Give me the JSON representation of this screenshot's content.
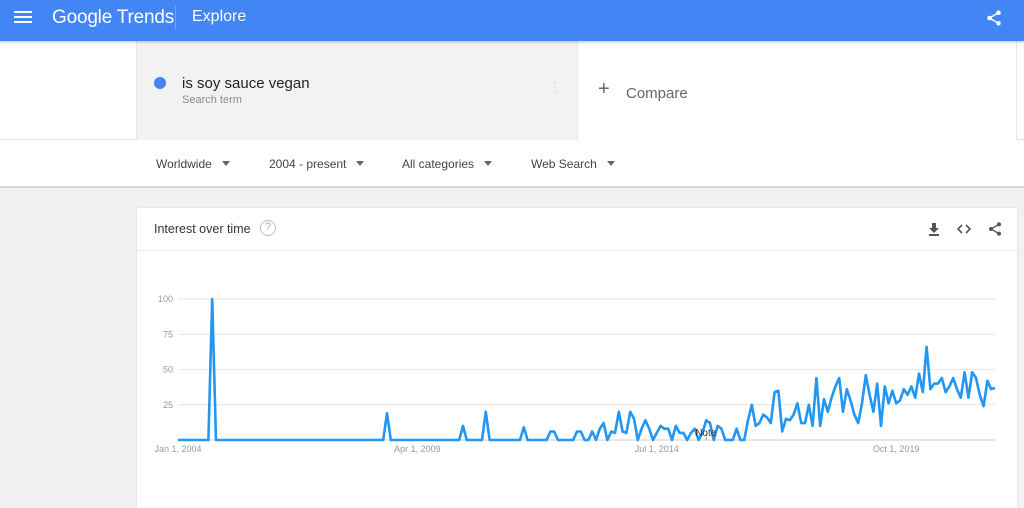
{
  "header": {
    "logo": "Google Trends",
    "section": "Explore",
    "menu_icon": "hamburger-menu-icon",
    "share_icon": "share-icon",
    "color": "#4285f4"
  },
  "search": {
    "term": "is soy sauce vegan",
    "term_type": "Search term",
    "term_color": "#4285f4",
    "compare_label": "Compare",
    "compare_icon": "+"
  },
  "filters": {
    "region": "Worldwide",
    "time_range": "2004 - present",
    "category": "All categories",
    "property": "Web Search"
  },
  "card": {
    "title": "Interest over time",
    "help_icon": "?",
    "actions": [
      "download-icon",
      "embed-icon",
      "share-icon"
    ]
  },
  "chart_data": {
    "type": "line",
    "title": "Interest over time",
    "series": [
      {
        "name": "is soy sauce vegan",
        "color": "#2196f3"
      }
    ],
    "x_start": "Jan 2004",
    "x_tick_labels": [
      "Jan 1, 2004",
      "Apr 1, 2009",
      "Jul 1, 2014",
      "Oct 1, 2019"
    ],
    "x_tick_months": [
      0,
      63,
      126,
      189
    ],
    "y_tick_labels": [
      "25",
      "50",
      "75",
      "100"
    ],
    "y_ticks": [
      25,
      50,
      75,
      100
    ],
    "ylim": [
      0,
      100
    ],
    "grid": true,
    "annotation": {
      "label": "Note",
      "month": 139
    },
    "values": [
      0,
      0,
      0,
      0,
      0,
      0,
      0,
      0,
      0,
      100,
      0,
      0,
      0,
      0,
      0,
      0,
      0,
      0,
      0,
      0,
      0,
      0,
      0,
      0,
      0,
      0,
      0,
      0,
      0,
      0,
      0,
      0,
      0,
      0,
      0,
      0,
      0,
      0,
      0,
      0,
      0,
      0,
      0,
      0,
      0,
      0,
      0,
      0,
      0,
      0,
      0,
      0,
      0,
      0,
      0,
      19,
      0,
      0,
      0,
      0,
      0,
      0,
      0,
      0,
      0,
      0,
      0,
      0,
      0,
      0,
      0,
      0,
      0,
      0,
      0,
      10,
      0,
      0,
      0,
      0,
      0,
      20,
      0,
      0,
      0,
      0,
      0,
      0,
      0,
      0,
      0,
      9,
      0,
      0,
      0,
      0,
      0,
      0,
      6,
      6,
      0,
      0,
      0,
      0,
      0,
      6,
      6,
      0,
      0,
      6,
      0,
      8,
      12,
      0,
      6,
      5,
      20,
      6,
      5,
      20,
      15,
      0,
      8,
      14,
      8,
      0,
      5,
      10,
      8,
      8,
      0,
      10,
      5,
      5,
      0,
      5,
      8,
      0,
      5,
      14,
      12,
      0,
      10,
      8,
      0,
      0,
      0,
      8,
      0,
      0,
      14,
      25,
      10,
      12,
      18,
      16,
      12,
      34,
      35,
      6,
      15,
      14,
      18,
      26,
      12,
      12,
      25,
      10,
      44,
      10,
      29,
      20,
      30,
      38,
      44,
      20,
      36,
      28,
      18,
      12,
      26,
      46,
      32,
      20,
      40,
      10,
      38,
      26,
      35,
      26,
      28,
      36,
      32,
      38,
      30,
      47,
      34,
      66,
      36,
      40,
      40,
      44,
      34,
      38,
      44,
      36,
      30,
      48,
      30,
      48,
      44,
      32,
      24,
      42,
      36,
      37
    ]
  }
}
